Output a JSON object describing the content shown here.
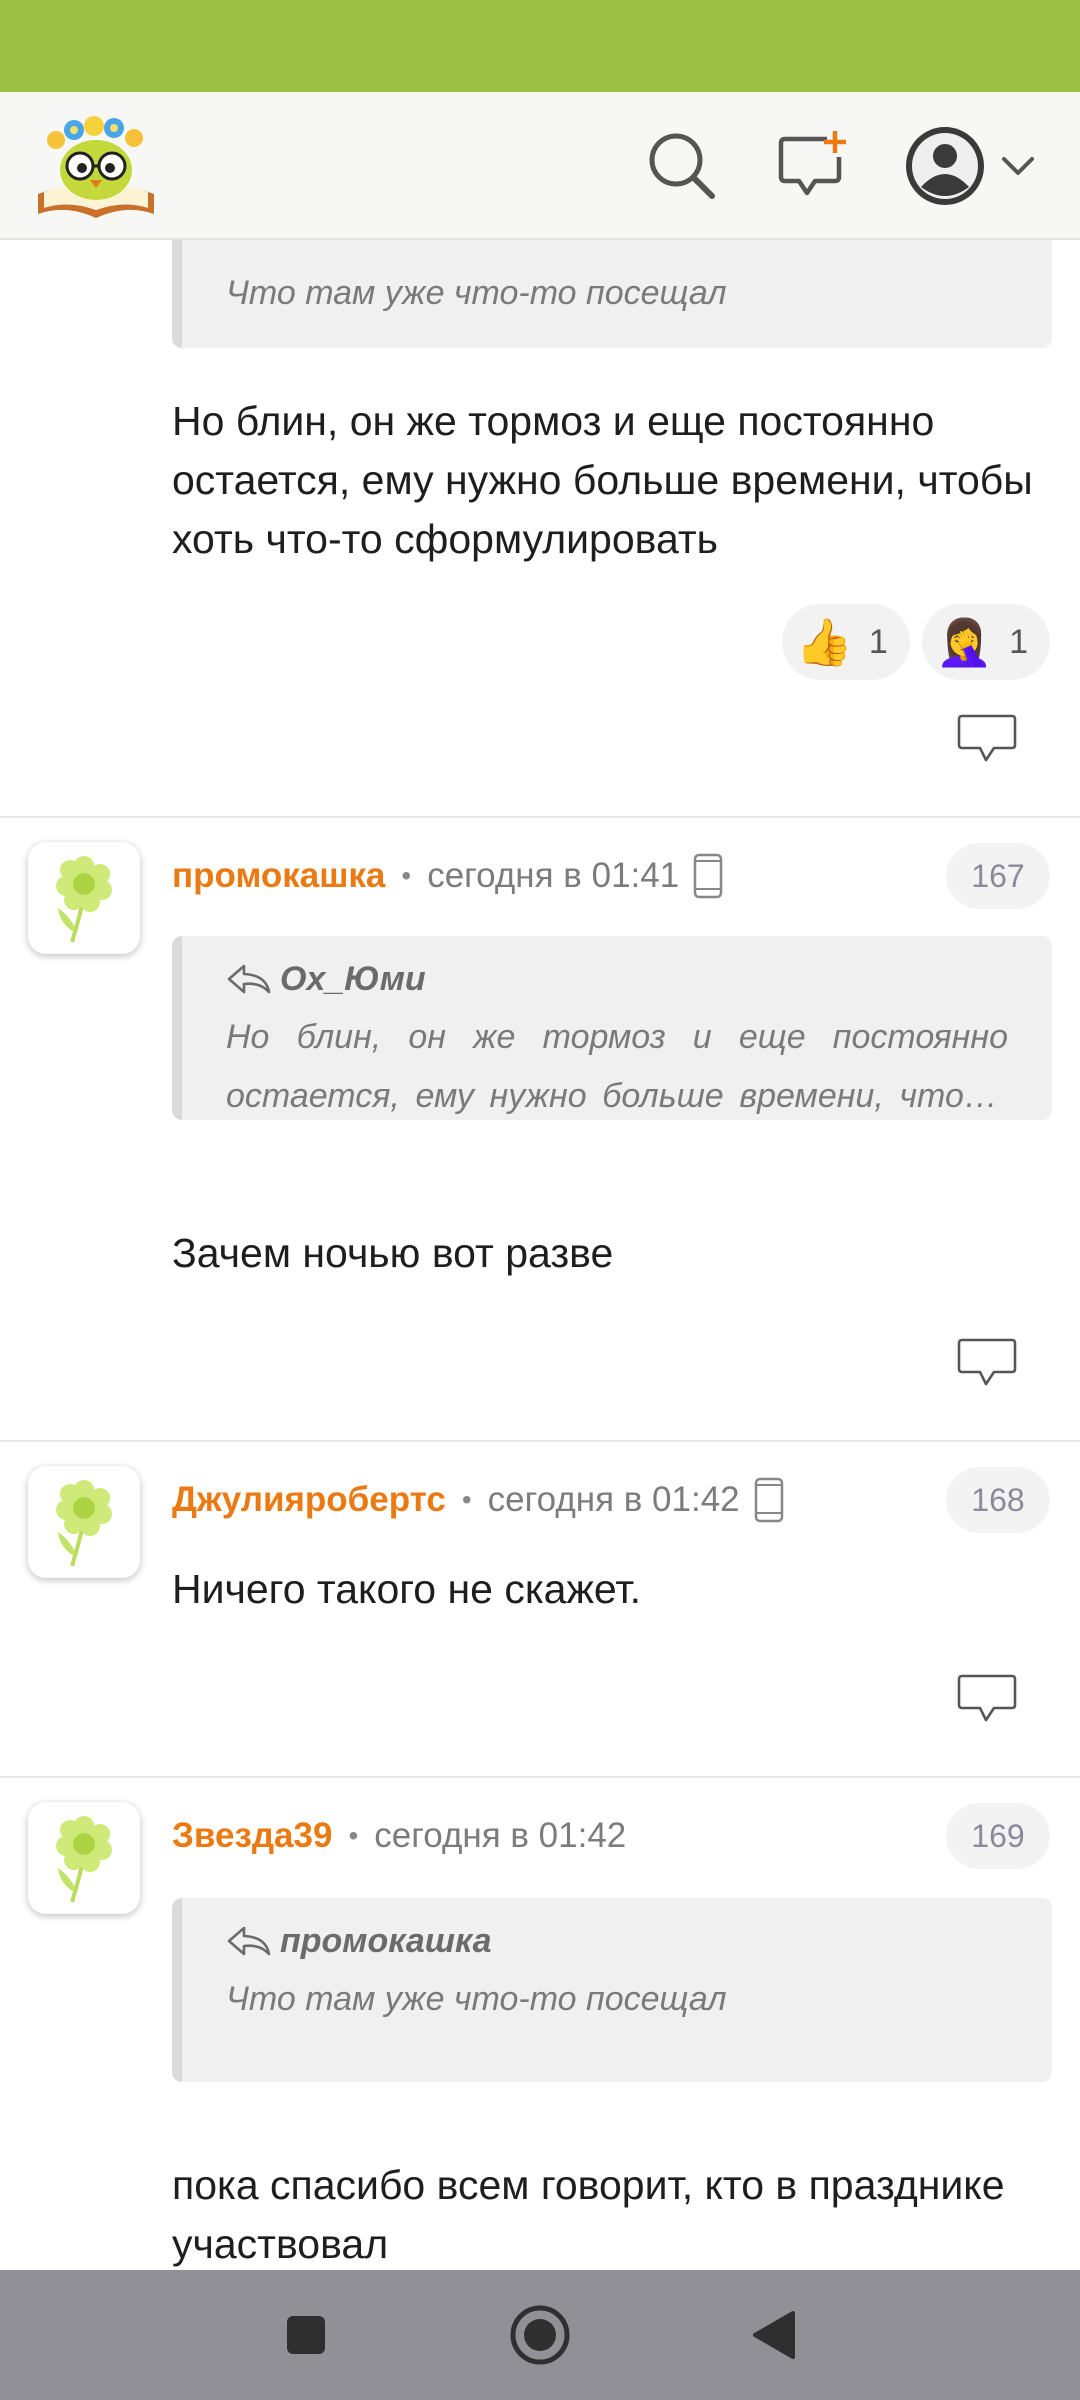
{
  "colors": {
    "status_bar": "#9dc145",
    "author": "#eb7a12",
    "nav_bar": "#909096"
  },
  "header": {
    "logo_icon": "owl-on-book-logo",
    "search_icon": "search-icon",
    "new_message_icon": "new-message-icon",
    "profile_icon": "avatar-icon"
  },
  "top_comment": {
    "quote_text": "Что там уже что-то посещал",
    "text": "Но блин, он же тормоз и еще постоянно остается, ему нужно больше времени, чтобы хоть что-то сформулировать",
    "reactions": [
      {
        "emoji": "👍",
        "count": "1"
      },
      {
        "emoji": "🤦‍♀️",
        "count": "1"
      }
    ]
  },
  "comments": [
    {
      "author": "промокашка",
      "separator": "•",
      "time": "сегодня в 01:41",
      "number": "167",
      "quote_author": "Ох_Юми",
      "quote_text": "Но блин, он же тормоз и еще постоянно остается, ему нужно больше времени, чтобы хоть что-то сформулировать",
      "text": "Зачем ночью вот разве"
    },
    {
      "author": "Джулияробертс",
      "separator": "•",
      "time": "сегодня в 01:42",
      "number": "168",
      "text": "Ничего такого не скажет."
    },
    {
      "author": "Звезда39",
      "separator": "•",
      "time": "сегодня в 01:42",
      "number": "169",
      "quote_author": "промокашка",
      "quote_text": "Что там уже что-то посещал",
      "text": "пока спасибо всем говорит, кто в празднике участвовал"
    }
  ]
}
